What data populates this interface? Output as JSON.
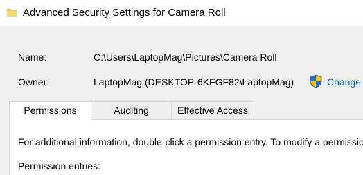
{
  "window": {
    "title": "Advanced Security Settings for Camera Roll"
  },
  "details": {
    "name_label": "Name:",
    "name_value": "C:\\Users\\LaptopMag\\Pictures\\Camera Roll",
    "owner_label": "Owner:",
    "owner_value": "LaptopMag (DESKTOP-6KFGF82\\LaptopMag)",
    "change_label": "Change"
  },
  "tabs": [
    {
      "label": "Permissions",
      "active": true
    },
    {
      "label": "Auditing",
      "active": false
    },
    {
      "label": "Effective Access",
      "active": false
    }
  ],
  "permissions": {
    "info_text": "For additional information, double-click a permission entry. To modify a permission entry, select the entry and click Edit (if available).",
    "entries_label": "Permission entries:"
  },
  "colors": {
    "link": "#0066cc",
    "folder": "#f8d775",
    "shield_blue": "#1f6fd0",
    "shield_yellow": "#f5c400"
  },
  "icons": {
    "title": "folder-icon",
    "owner_change": "uac-shield-icon"
  }
}
